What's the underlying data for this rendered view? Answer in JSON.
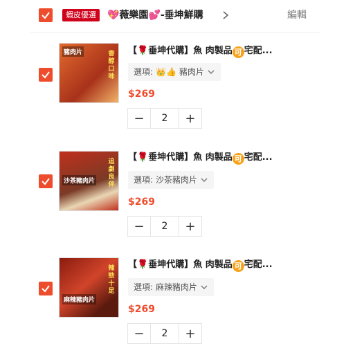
{
  "shop": {
    "badge": "蝦皮優選",
    "heart_left": "💖",
    "name": "薇樂園",
    "heart_right": "💕",
    "suffix": "-垂坤鮮購",
    "edit_label": "編輯",
    "accent_color": "#ee4d2d"
  },
  "items": [
    {
      "title_prefix": "【",
      "rose": "🌹",
      "title_main": "垂坤代購】魚 肉製品",
      "title_circle": "可",
      "title_suffix": "宅配...",
      "variant_label": "選項: ",
      "variant_emoji": "👑👍",
      "variant_value": "豬肉片",
      "price": "$269",
      "quantity": "2",
      "thumb_label": "豬肉片",
      "thumb_side": "香醇口味",
      "thumb_bg": "#c94a24"
    },
    {
      "title_prefix": "【",
      "rose": "🌹",
      "title_main": "垂坤代購】魚 肉製品",
      "title_circle": "可",
      "title_suffix": "宅配...",
      "variant_label": "選項: ",
      "variant_emoji": "",
      "variant_value": "沙茶豬肉片",
      "price": "$269",
      "quantity": "2",
      "thumb_label": "沙茶豬肉片",
      "thumb_side": "追劇良伴",
      "thumb_bg": "#b13a1f"
    },
    {
      "title_prefix": "【",
      "rose": "🌹",
      "title_main": "垂坤代購】魚 肉製品",
      "title_circle": "可",
      "title_suffix": "宅配...",
      "variant_label": "選項: ",
      "variant_emoji": "",
      "variant_value": "麻辣豬肉片",
      "price": "$269",
      "quantity": "2",
      "thumb_label": "麻辣豬肉片",
      "thumb_side": "辣勁十足",
      "thumb_bg": "#a02a16"
    }
  ],
  "qty_minus": "−",
  "qty_plus": "+"
}
